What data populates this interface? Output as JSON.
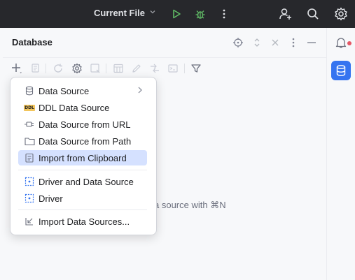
{
  "topbar": {
    "run_config": "Current File",
    "icons": [
      "chevron-down-icon",
      "run-icon",
      "debug-icon",
      "more-icon",
      "add-user-icon",
      "search-icon",
      "gear-icon"
    ]
  },
  "panel": {
    "title": "Database",
    "empty_hint": "a source with ⌘N"
  },
  "menu": {
    "items": [
      {
        "label": "Data Source",
        "icon": "database-icon",
        "has_submenu": true
      },
      {
        "label": "DDL Data Source",
        "icon": "ddl-icon",
        "badge": "DDL"
      },
      {
        "label": "Data Source from URL",
        "icon": "plug-icon"
      },
      {
        "label": "Data Source from Path",
        "icon": "folder-icon"
      },
      {
        "label": "Import from Clipboard",
        "icon": "clipboard-icon",
        "selected": true
      },
      {
        "label": "Driver and Data Source",
        "icon": "driver-icon"
      },
      {
        "label": "Driver",
        "icon": "driver-icon"
      },
      {
        "label": "Import Data Sources...",
        "icon": "import-icon"
      }
    ]
  },
  "colors": {
    "topbar_bg": "#27282c",
    "accent": "#3574f0",
    "run_green": "#5fb865",
    "selected_bg": "#d5e1ff",
    "notification": "#e55765"
  }
}
